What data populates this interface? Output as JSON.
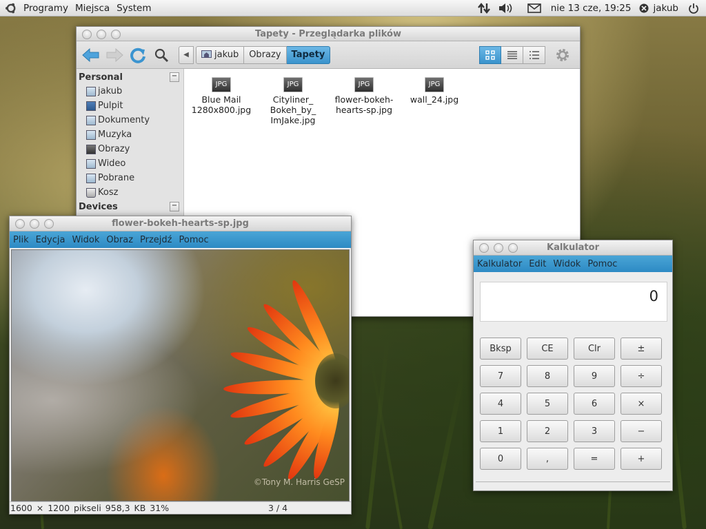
{
  "panel": {
    "menus": [
      "Programy",
      "Miejsca",
      "System"
    ],
    "clock": "nie 13 cze, 19:25",
    "user": "jakub",
    "icons": [
      "network-icon",
      "volume-icon",
      "mail-icon",
      "user-status-icon",
      "power-icon"
    ]
  },
  "file_manager": {
    "title": "Tapety - Przeglądarka plików",
    "breadcrumbs": [
      "jakub",
      "Obrazy",
      "Tapety"
    ],
    "sidebar": {
      "personal_heading": "Personal",
      "items": [
        "jakub",
        "Pulpit",
        "Dokumenty",
        "Muzyka",
        "Obrazy",
        "Wideo",
        "Pobrane",
        "Kosz"
      ],
      "devices_heading": "Devices"
    },
    "files": [
      {
        "type": "JPG",
        "name_lines": [
          "Blue Mail",
          "1280x800.jpg"
        ]
      },
      {
        "type": "JPG",
        "name_lines": [
          "Cityliner_",
          "Bokeh_by_",
          "ImJake.jpg"
        ]
      },
      {
        "type": "JPG",
        "name_lines": [
          "flower-bokeh-",
          "hearts-sp.jpg"
        ]
      },
      {
        "type": "JPG",
        "name_lines": [
          "wall_24.jpg"
        ]
      }
    ]
  },
  "image_viewer": {
    "title": "flower-bokeh-hearts-sp.jpg",
    "menus": [
      "Plik",
      "Edycja",
      "Widok",
      "Obraz",
      "Przejdź",
      "Pomoc"
    ],
    "watermark": "©Tony M. Harris GeSP",
    "status_info": "1600 × 1200 pikseli  958,3 KB   31%",
    "status_page": "3 / 4"
  },
  "calculator": {
    "title": "Kalkulator",
    "menus": [
      "Kalkulator",
      "Edit",
      "Widok",
      "Pomoc"
    ],
    "display": "0",
    "keys": [
      "Bksp",
      "CE",
      "Clr",
      "±",
      "7",
      "8",
      "9",
      "÷",
      "4",
      "5",
      "6",
      "×",
      "1",
      "2",
      "3",
      "−",
      "0",
      ",",
      "=",
      "+"
    ]
  },
  "colors": {
    "menubar_blue": "#3a95cc",
    "breadcrumb_active": "#4aa1d8"
  }
}
